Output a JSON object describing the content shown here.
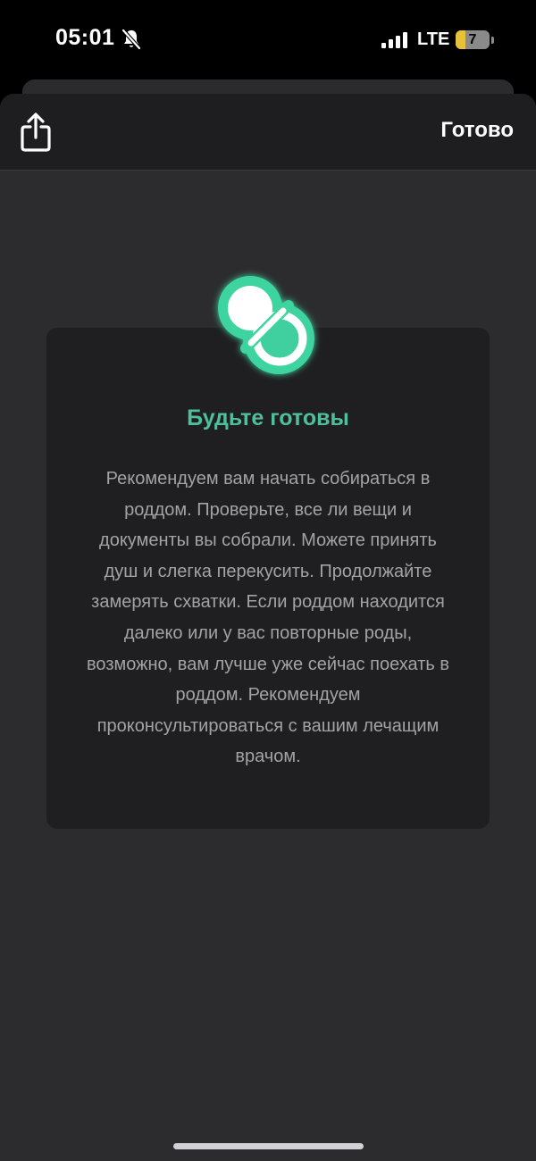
{
  "status_bar": {
    "time": "05:01",
    "network": "LTE",
    "battery_level": "7",
    "battery_fraction": 0.3
  },
  "nav": {
    "done_label": "Готово",
    "share_icon": "share-icon"
  },
  "card": {
    "icon": "pacifier-icon",
    "title": "Будьте готовы",
    "text": "Рекомендуем вам начать собираться в роддом. Проверьте, все ли вещи и документы вы собрали. Можете принять душ и слегка перекусить. Продолжайте замерять схватки. Если роддом находится далеко или у вас повторные роды, возможно, вам лучше уже сейчас поехать в роддом. Рекомендуем проконсультироваться с вашим лечащим врачом."
  },
  "colors": {
    "accent": "#4fbf9a",
    "sheet_background": "#2c2c2e",
    "card_background": "#1f1f21",
    "text_secondary": "#a3a3a6"
  }
}
